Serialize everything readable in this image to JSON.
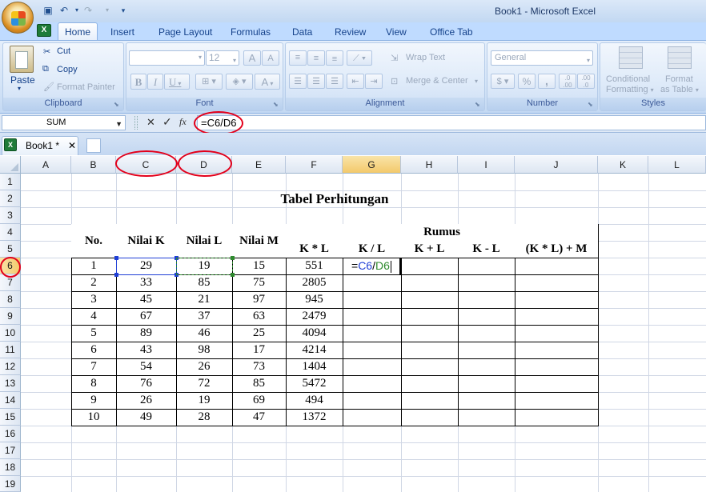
{
  "window": {
    "title": "Book1 - Microsoft Excel"
  },
  "qat": {
    "save_icon": "save-icon",
    "undo_icon": "undo-icon",
    "redo_icon": "redo-icon"
  },
  "tabs": [
    "Home",
    "Insert",
    "Page Layout",
    "Formulas",
    "Data",
    "Review",
    "View",
    "Office Tab"
  ],
  "ribbon": {
    "clipboard": {
      "label": "Clipboard",
      "paste": "Paste",
      "cut": "Cut",
      "copy": "Copy",
      "format_painter": "Format Painter"
    },
    "font": {
      "label": "Font",
      "size": "12",
      "bold": "B",
      "italic": "I",
      "underline": "U",
      "grow": "A",
      "shrink": "A"
    },
    "alignment": {
      "label": "Alignment",
      "wrap_text": "Wrap Text",
      "merge_center": "Merge & Center"
    },
    "number": {
      "label": "Number",
      "format": "General",
      "percent": "%",
      "comma": ",",
      "inc_dec": ".0\n.00",
      "dec_dec": ".00\n.0"
    },
    "styles": {
      "label": "Styles",
      "conditional": "Conditional",
      "formatting": "Formatting",
      "format_as": "Format",
      "as_table": "as Table"
    }
  },
  "formula_bar": {
    "name_box": "SUM",
    "cancel": "✕",
    "enter": "✓",
    "fx": "fx",
    "formula": "=C6/D6"
  },
  "workbook_tab": {
    "label": "Book1 *",
    "close": "✕"
  },
  "columns": [
    "A",
    "B",
    "C",
    "D",
    "E",
    "F",
    "G",
    "H",
    "I",
    "J",
    "K",
    "L"
  ],
  "rows": [
    "1",
    "2",
    "3",
    "4",
    "5",
    "6",
    "7",
    "8",
    "9",
    "10",
    "11",
    "12",
    "13",
    "14",
    "15",
    "16",
    "17",
    "18",
    "19"
  ],
  "sheet": {
    "title": "Tabel Perhitungan",
    "header": {
      "no": "No.",
      "nilai_k": "Nilai K",
      "nilai_l": "Nilai L",
      "nilai_m": "Nilai M",
      "rumus": "Rumus",
      "k_times_l": "K * L",
      "k_div_l": "K / L",
      "k_plus_l": "K + L",
      "k_minus_l": "K - L",
      "formula_m": "(K * L) + M"
    },
    "data": [
      [
        "1",
        "29",
        "19",
        "15",
        "551"
      ],
      [
        "2",
        "33",
        "85",
        "75",
        "2805"
      ],
      [
        "3",
        "45",
        "21",
        "97",
        "945"
      ],
      [
        "4",
        "67",
        "37",
        "63",
        "2479"
      ],
      [
        "5",
        "89",
        "46",
        "25",
        "4094"
      ],
      [
        "6",
        "43",
        "98",
        "17",
        "4214"
      ],
      [
        "7",
        "54",
        "26",
        "73",
        "1404"
      ],
      [
        "8",
        "76",
        "72",
        "85",
        "5472"
      ],
      [
        "9",
        "26",
        "19",
        "69",
        "494"
      ],
      [
        "10",
        "49",
        "28",
        "47",
        "1372"
      ]
    ],
    "edit_cell": {
      "eq": "=",
      "ref1": "C6",
      "op": "/",
      "ref2": "D6"
    }
  },
  "colors": {
    "ref1": "#1f3fd6",
    "ref2": "#2e8b2e",
    "annotation": "#e3001b"
  }
}
